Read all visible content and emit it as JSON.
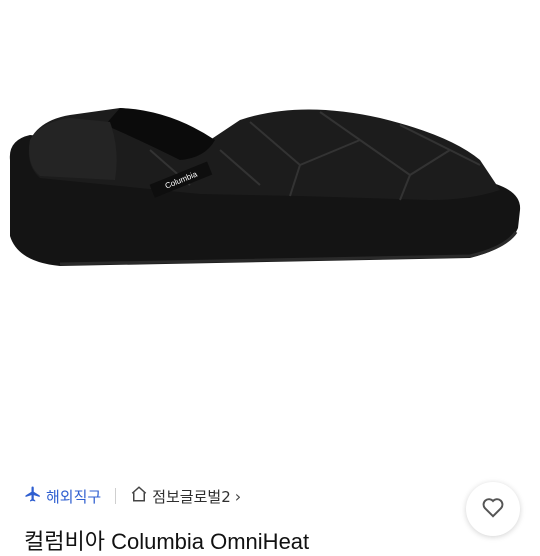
{
  "product": {
    "image_alt": "Columbia Omni-Heat black quilted slip-on shoe",
    "logo_text": "Columbia",
    "badge": "해외직구",
    "store_name": "점보글로벌2",
    "store_chevron": "›",
    "title": "컬럼비아 Columbia OmniHeat"
  },
  "icons": {
    "badge": "airplane-icon",
    "store": "home-icon",
    "like": "heart-outline-icon"
  },
  "colors": {
    "accent": "#2f5fd0",
    "text": "#111111"
  }
}
